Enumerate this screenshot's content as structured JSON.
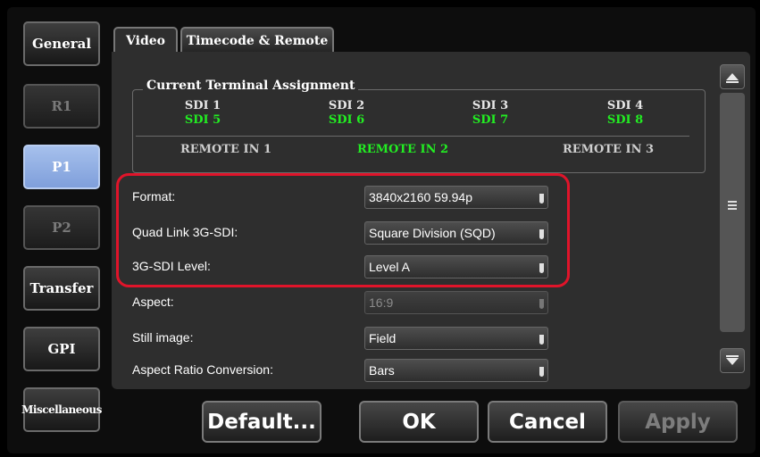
{
  "sidebar": {
    "items": [
      {
        "label": "General"
      },
      {
        "label": "R1"
      },
      {
        "label": "P1"
      },
      {
        "label": "P2"
      },
      {
        "label": "Transfer"
      },
      {
        "label": "GPI"
      },
      {
        "label": "Miscellaneous"
      }
    ]
  },
  "tabs": [
    {
      "label": "Video"
    },
    {
      "label": "Timecode & Remote"
    }
  ],
  "assignment": {
    "title": "Current Terminal Assignment",
    "sdi": [
      {
        "top": "SDI 1",
        "bottom": "SDI 5"
      },
      {
        "top": "SDI 2",
        "bottom": "SDI 6"
      },
      {
        "top": "SDI 3",
        "bottom": "SDI 7"
      },
      {
        "top": "SDI 4",
        "bottom": "SDI 8"
      }
    ],
    "remotes": [
      "REMOTE IN 1",
      "REMOTE IN 2",
      "REMOTE IN 3"
    ],
    "active_remote": "REMOTE IN 2"
  },
  "settings": [
    {
      "label": "Format:",
      "value": "3840x2160 59.94p"
    },
    {
      "label": "Quad Link 3G-SDI:",
      "value": "Square Division (SQD)"
    },
    {
      "label": "3G-SDI Level:",
      "value": "Level A"
    },
    {
      "label": "Aspect:",
      "value": "16:9"
    },
    {
      "label": "Still image:",
      "value": "Field"
    },
    {
      "label": "Aspect Ratio Conversion:",
      "value": "Bars"
    }
  ],
  "buttons": {
    "default": "Default...",
    "ok": "OK",
    "cancel": "Cancel",
    "apply": "Apply"
  },
  "colors": {
    "active_green": "#22ee22",
    "selected_blue": "#8faee3",
    "highlight_red": "#e0142a"
  }
}
